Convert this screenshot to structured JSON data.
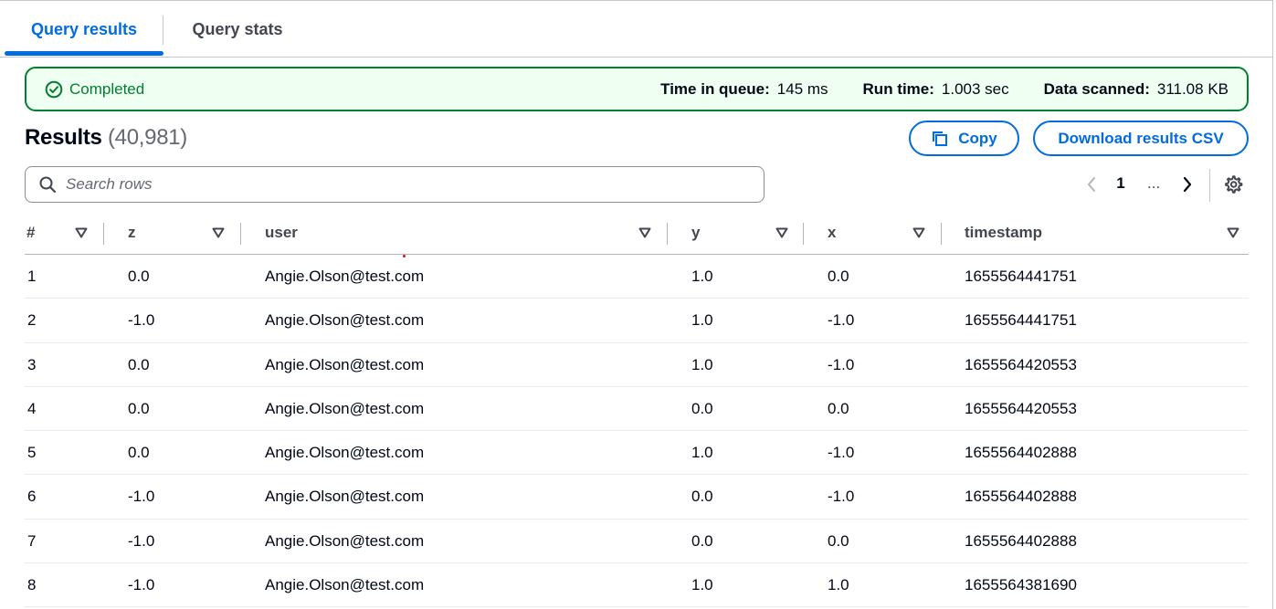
{
  "tabs": [
    {
      "label": "Query results",
      "active": true
    },
    {
      "label": "Query stats",
      "active": false
    }
  ],
  "status": {
    "label": "Completed",
    "color": "#00802f",
    "time_in_queue_label": "Time in queue:",
    "time_in_queue_value": "145 ms",
    "run_time_label": "Run time:",
    "run_time_value": "1.003 sec",
    "data_scanned_label": "Data scanned:",
    "data_scanned_value": "311.08 KB"
  },
  "results": {
    "title": "Results",
    "count": "(40,981)",
    "copy_label": "Copy",
    "download_label": "Download results CSV"
  },
  "search": {
    "placeholder": "Search rows"
  },
  "pagination": {
    "current_page": "1",
    "ellipsis": "..."
  },
  "table": {
    "columns": [
      "#",
      "z",
      "user",
      "y",
      "x",
      "timestamp"
    ],
    "rows": [
      [
        "1",
        "0.0",
        "Angie.Olson@test.com",
        "1.0",
        "0.0",
        "1655564441751"
      ],
      [
        "2",
        "-1.0",
        "Angie.Olson@test.com",
        "1.0",
        "-1.0",
        "1655564441751"
      ],
      [
        "3",
        "0.0",
        "Angie.Olson@test.com",
        "1.0",
        "-1.0",
        "1655564420553"
      ],
      [
        "4",
        "0.0",
        "Angie.Olson@test.com",
        "0.0",
        "0.0",
        "1655564420553"
      ],
      [
        "5",
        "0.0",
        "Angie.Olson@test.com",
        "1.0",
        "-1.0",
        "1655564402888"
      ],
      [
        "6",
        "-1.0",
        "Angie.Olson@test.com",
        "0.0",
        "-1.0",
        "1655564402888"
      ],
      [
        "7",
        "-1.0",
        "Angie.Olson@test.com",
        "0.0",
        "0.0",
        "1655564402888"
      ],
      [
        "8",
        "-1.0",
        "Angie.Olson@test.com",
        "1.0",
        "1.0",
        "1655564381690"
      ]
    ]
  },
  "colors": {
    "accent": "#006ce0",
    "success": "#00802f",
    "success_bg": "#effff1"
  }
}
